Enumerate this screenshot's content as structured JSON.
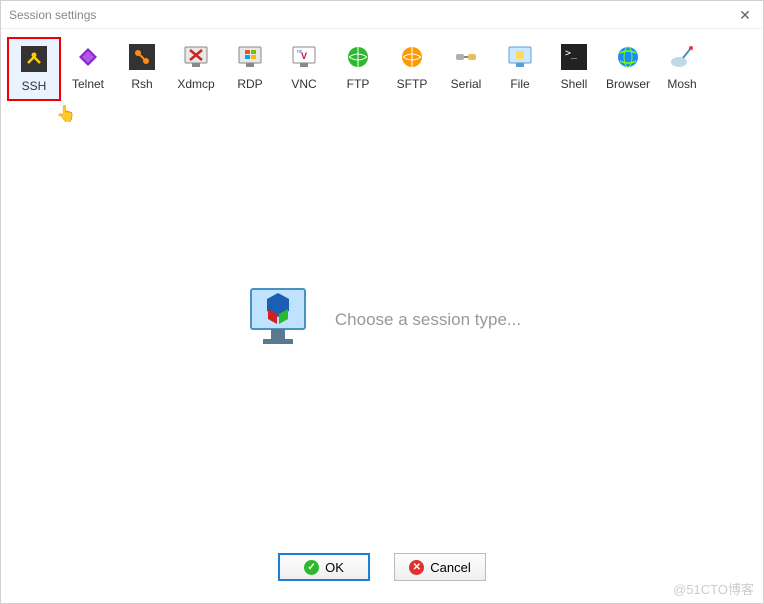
{
  "window": {
    "title": "Session settings"
  },
  "toolbar": {
    "items": [
      {
        "label": "SSH",
        "icon": "ssh-icon",
        "selected": true
      },
      {
        "label": "Telnet",
        "icon": "telnet-icon"
      },
      {
        "label": "Rsh",
        "icon": "rsh-icon"
      },
      {
        "label": "Xdmcp",
        "icon": "xdmcp-icon"
      },
      {
        "label": "RDP",
        "icon": "rdp-icon"
      },
      {
        "label": "VNC",
        "icon": "vnc-icon"
      },
      {
        "label": "FTP",
        "icon": "ftp-icon"
      },
      {
        "label": "SFTP",
        "icon": "sftp-icon"
      },
      {
        "label": "Serial",
        "icon": "serial-icon"
      },
      {
        "label": "File",
        "icon": "file-icon"
      },
      {
        "label": "Shell",
        "icon": "shell-icon"
      },
      {
        "label": "Browser",
        "icon": "browser-icon"
      },
      {
        "label": "Mosh",
        "icon": "mosh-icon"
      }
    ]
  },
  "content": {
    "hint": "Choose a session type..."
  },
  "buttons": {
    "ok": "OK",
    "cancel": "Cancel"
  },
  "watermark": "@51CTO博客"
}
